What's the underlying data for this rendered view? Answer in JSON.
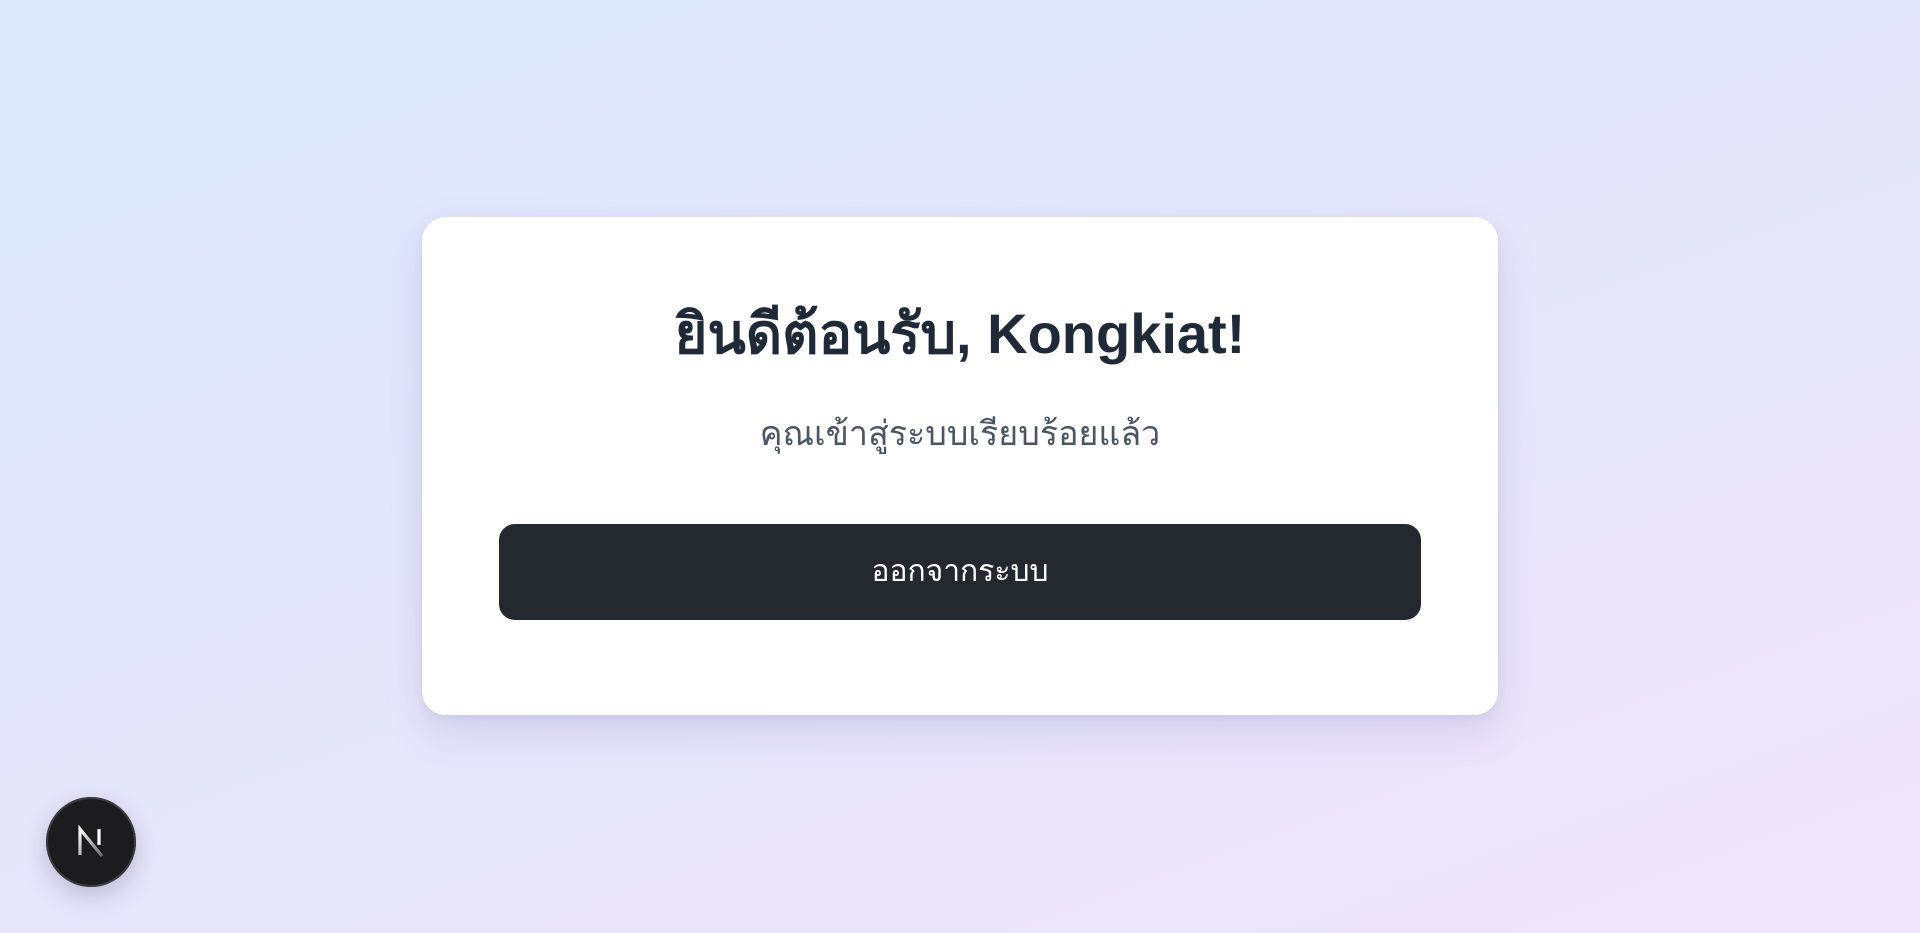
{
  "card": {
    "title": "ยินดีต้อนรับ, Kongkiat!",
    "subtitle": "คุณเข้าสู่ระบบเรียบร้อยแล้ว",
    "logout_label": "ออกจากระบบ"
  },
  "dev_badge": {
    "icon": "nextjs-logo-icon"
  },
  "colors": {
    "button_bg": "#24282f",
    "title_text": "#1f2937",
    "subtitle_text": "#4b5563"
  }
}
